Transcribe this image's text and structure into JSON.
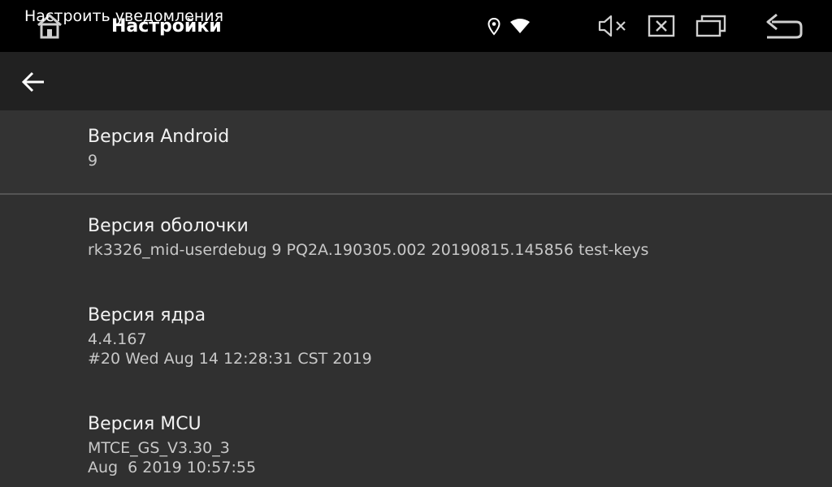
{
  "statusbar": {
    "notification_text": "Настроить уведомления",
    "app_title": "Настройки",
    "icons": [
      "home-icon",
      "location-icon",
      "wifi-icon",
      "volume-muted-icon",
      "close-window-icon",
      "recent-apps-icon",
      "back-nav-icon"
    ]
  },
  "toolbar": {
    "icon": "back-arrow-icon"
  },
  "items": [
    {
      "title": "Версия Android",
      "lines": [
        "9"
      ]
    },
    {
      "title": "Версия оболочки",
      "lines": [
        "rk3326_mid-userdebug 9 PQ2A.190305.002 20190815.145856 test-keys"
      ]
    },
    {
      "title": "Версия ядра",
      "lines": [
        "4.4.167",
        "#20 Wed Aug 14 12:28:31 CST 2019"
      ]
    },
    {
      "title": "Версия MCU",
      "lines": [
        "MTCE_GS_V3.30_3",
        "Aug  6 2019 10:57:55"
      ]
    }
  ],
  "colors": {
    "statusbar": "#000000",
    "toolbar": "#212121",
    "background": "#303030",
    "divider": "#555555"
  }
}
